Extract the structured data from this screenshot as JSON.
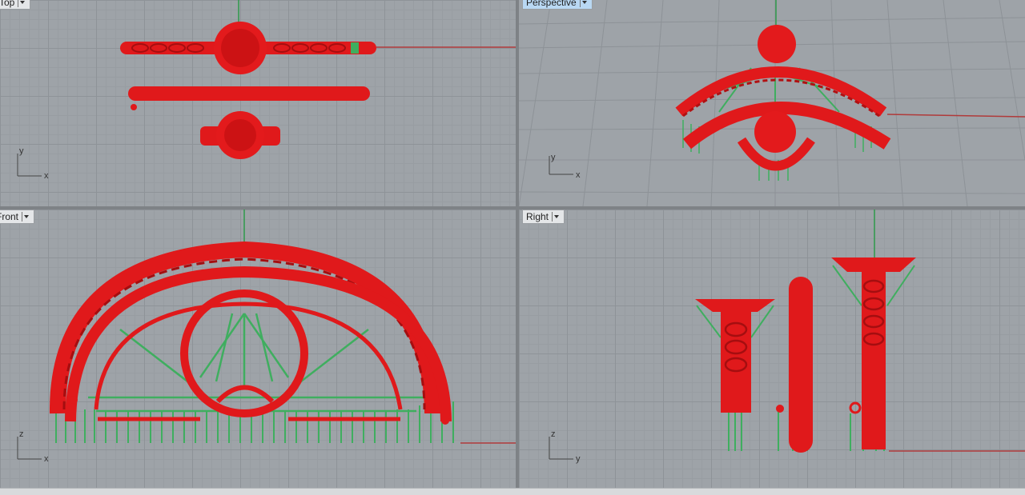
{
  "viewports": {
    "top": {
      "label": "Top",
      "axis_h": "x",
      "axis_v": "y"
    },
    "persp": {
      "label": "Perspective",
      "axis_h": "x",
      "axis_v": "y"
    },
    "front": {
      "label": "Front",
      "axis_h": "x",
      "axis_v": "z"
    },
    "right": {
      "label": "Right",
      "axis_h": "y",
      "axis_v": "z"
    }
  },
  "colors": {
    "model": "#e0191b",
    "support": "#3fae5f",
    "viewport_bg": "#9ea3a8",
    "grid": "#8e9398",
    "x_axis": "#b03a3a",
    "y_axis": "#2f9a4a"
  },
  "icons": [
    "dropdown-arrow-icon"
  ]
}
